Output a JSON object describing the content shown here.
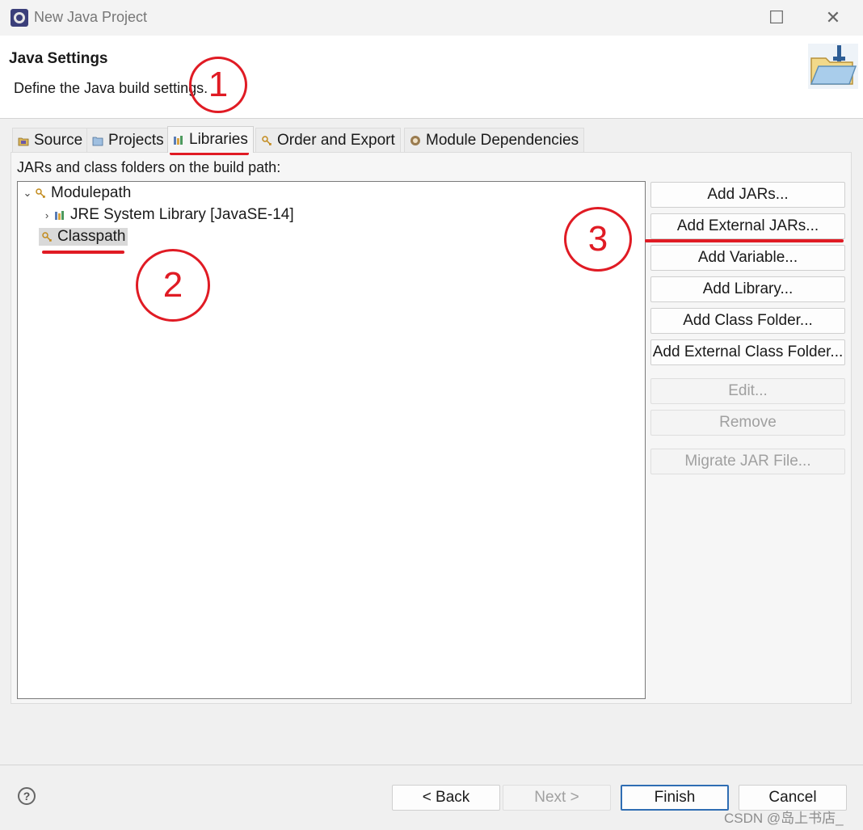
{
  "window": {
    "title": "New Java Project",
    "maximize_glyph": "☐",
    "close_glyph": "✕"
  },
  "banner": {
    "title": "Java Settings",
    "description": "Define the Java build settings."
  },
  "tabs": [
    {
      "label": "Source",
      "icon": "source-icon",
      "active": false
    },
    {
      "label": "Projects",
      "icon": "projects-icon",
      "active": false
    },
    {
      "label": "Libraries",
      "icon": "libraries-icon",
      "active": true
    },
    {
      "label": "Order and Export",
      "icon": "order-icon",
      "active": false
    },
    {
      "label": "Module Dependencies",
      "icon": "module-icon",
      "active": false
    }
  ],
  "libraries": {
    "label": "JARs and class folders on the build path:",
    "tree": [
      {
        "label": "Modulepath",
        "expanded": true,
        "icon": "modulepath-icon"
      },
      {
        "label": "JRE System Library [JavaSE-14]",
        "expanded": false,
        "icon": "library-icon"
      },
      {
        "label": "Classpath",
        "selected": true,
        "icon": "classpath-icon"
      }
    ],
    "buttons": [
      {
        "label": "Add JARs...",
        "enabled": true
      },
      {
        "label": "Add External JARs...",
        "enabled": true
      },
      {
        "label": "Add Variable...",
        "enabled": true
      },
      {
        "label": "Add Library...",
        "enabled": true
      },
      {
        "label": "Add Class Folder...",
        "enabled": true
      },
      {
        "label": "Add External Class Folder...",
        "enabled": true
      },
      {
        "label": "Edit...",
        "enabled": false
      },
      {
        "label": "Remove",
        "enabled": false
      },
      {
        "label": "Migrate JAR File...",
        "enabled": false
      }
    ]
  },
  "footer": {
    "help_glyph": "?",
    "back_label": "< Back",
    "next_label": "Next >",
    "finish_label": "Finish",
    "cancel_label": "Cancel"
  },
  "annotations": {
    "step1": "1",
    "step2": "2",
    "step3": "3",
    "color": "#e01b24"
  },
  "watermark": "CSDN @岛上书店_"
}
